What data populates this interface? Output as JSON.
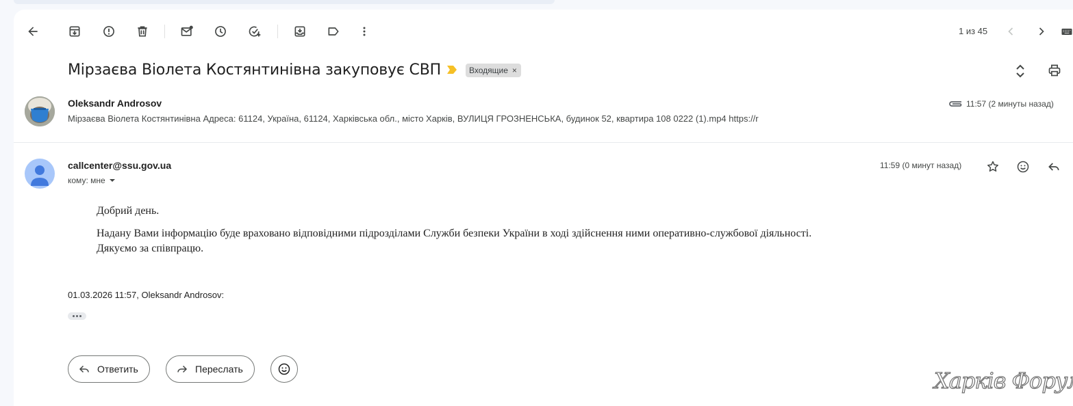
{
  "toolbar": {
    "icons": [
      "back-icon",
      "archive-icon",
      "report-spam-icon",
      "delete-icon",
      "mark-unread-icon",
      "snooze-icon",
      "add-task-icon",
      "move-to-icon",
      "label-icon",
      "more-icon"
    ],
    "pager": "1 из 45"
  },
  "thread": {
    "subject": "Мірзаєва Віолета Костянтинівна закуповує СВП",
    "label": "Входящие",
    "label_remove": "×"
  },
  "messages": [
    {
      "sender": "Oleksandr Androsov",
      "snippet": "Мірзаєва Віолета Костянтинівна Адреса: 61124, Україна, 61124, Харківська обл., місто Харків, ВУЛИЦЯ ГРОЗНЕНСЬКА, будинок 52, квартира 108 0222 (1).mp4 https://r",
      "time": "11:57 (2 минуты назад)"
    },
    {
      "sender": "callcenter@ssu.gov.ua",
      "recipient": "кому: мне",
      "time": "11:59 (0 минут назад)",
      "body": [
        "Добрий день.",
        "Надану Вами інформацію буде враховано відповідними підрозділами Служби безпеки України в ході здійснення ними оперативно-службової діяльності.",
        "Дякуємо за співпрацю."
      ],
      "quote_header": "01.03.2026 11:57, Oleksandr Androsov:"
    }
  ],
  "actions": {
    "reply": "Ответить",
    "forward": "Переслать"
  },
  "watermark": "Харків Форум",
  "colors": {
    "background": "#f6f8fc",
    "panel": "#ffffff",
    "importance": "#f6c026",
    "label_chip": "#dddddd",
    "avatar": "#a8c7fa",
    "avatar_figure": "#4179dd"
  }
}
